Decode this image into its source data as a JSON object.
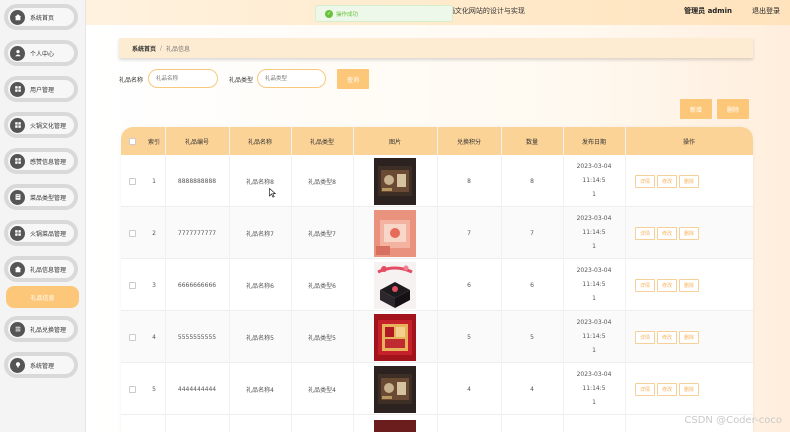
{
  "header": {
    "title": "基于Spring Boot的四川火锅文化网站的设计与实现",
    "user": "管理员 admin",
    "logout": "退出登录",
    "toast": "操作成功"
  },
  "sidebar": {
    "items": [
      {
        "label": "系统首页",
        "icon": "home-icon"
      },
      {
        "label": "个人中心",
        "icon": "user-icon"
      },
      {
        "label": "用户管理",
        "icon": "grid-icon"
      },
      {
        "label": "火锅文化管理",
        "icon": "grid-icon"
      },
      {
        "label": "感赞信息管理",
        "icon": "grid-icon"
      },
      {
        "label": "菜品类型管理",
        "icon": "doc-icon"
      },
      {
        "label": "火锅菜品管理",
        "icon": "grid-icon"
      },
      {
        "label": "礼品信息管理",
        "icon": "home-icon"
      },
      {
        "label": "礼品兑换管理",
        "icon": "list-icon"
      },
      {
        "label": "系统管理",
        "icon": "pin-icon"
      }
    ],
    "active_sub": "礼品信息"
  },
  "breadcrumb": {
    "home": "系统首页",
    "separator": "/",
    "current": "礼品信息"
  },
  "filters": {
    "name_label": "礼品名称",
    "name_placeholder": "礼品名称",
    "type_label": "礼品类型",
    "type_placeholder": "礼品类型",
    "search_label": "查询"
  },
  "toolbar": {
    "add_label": "新增",
    "delete_label": "删除"
  },
  "table": {
    "columns": [
      "索引",
      "礼品编号",
      "礼品名称",
      "礼品类型",
      "图片",
      "兑换积分",
      "数量",
      "发布日期",
      "操作"
    ],
    "action_labels": {
      "detail": "详情",
      "edit": "修改",
      "delete": "删除"
    },
    "rows": [
      {
        "index": "1",
        "code": "8888888888",
        "name": "礼品名称8",
        "type": "礼品类型8",
        "image": "dark-gift-box",
        "points": "8",
        "qty": "8",
        "date_line1": "2023-03-04 11:14:5",
        "date_line2": "1"
      },
      {
        "index": "2",
        "code": "7777777777",
        "name": "礼品名称7",
        "type": "礼品类型7",
        "image": "pink-gift-box",
        "points": "7",
        "qty": "7",
        "date_line1": "2023-03-04 11:14:5",
        "date_line2": "1"
      },
      {
        "index": "3",
        "code": "6666666666",
        "name": "礼品名称6",
        "type": "礼品类型6",
        "image": "explosion-box",
        "points": "6",
        "qty": "6",
        "date_line1": "2023-03-04 11:14:5",
        "date_line2": "1"
      },
      {
        "index": "4",
        "code": "5555555555",
        "name": "礼品名称5",
        "type": "礼品类型5",
        "image": "red-gift-box",
        "points": "5",
        "qty": "5",
        "date_line1": "2023-03-04 11:14:5",
        "date_line2": "1"
      },
      {
        "index": "5",
        "code": "4444444444",
        "name": "礼品名称4",
        "type": "礼品类型4",
        "image": "dark-gift-box",
        "points": "4",
        "qty": "4",
        "date_line1": "2023-03-04 11:14:5",
        "date_line2": "1"
      }
    ]
  },
  "watermark": "CSDN @Coder-coco",
  "colors": {
    "accent": "#fcc778",
    "header_bg": "#fcd396",
    "success": "#67c23a"
  }
}
